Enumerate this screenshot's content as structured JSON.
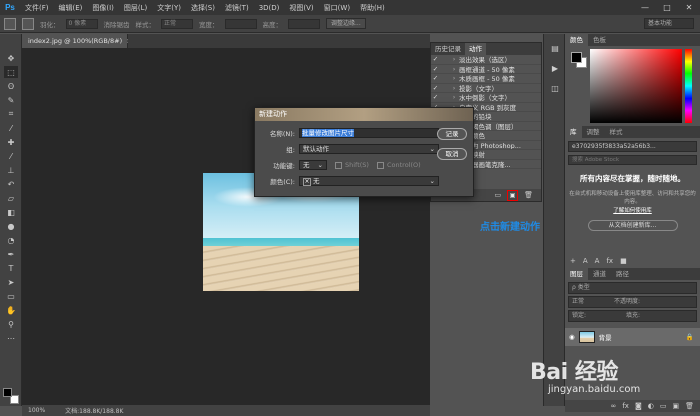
{
  "menu": {
    "logo": "Ps",
    "items": [
      "文件(F)",
      "编辑(E)",
      "图像(I)",
      "图层(L)",
      "文字(Y)",
      "选择(S)",
      "滤镜(T)",
      "3D(D)",
      "视图(V)",
      "窗口(W)",
      "帮助(H)"
    ],
    "controls": [
      "—",
      "□",
      "✕"
    ]
  },
  "options_bar": {
    "feather_label": "羽化：",
    "feather_value": "0 像素",
    "antialias_label": "消除锯齿",
    "style_label": "样式：",
    "style_value": "正常",
    "width_label": "宽度：",
    "height_label": "高度：",
    "refine_button": "调整边缘...",
    "workspace": "基本功能"
  },
  "document": {
    "tab_title": "index2.jpg @ 100%(RGB/8#)",
    "close_glyph": "×",
    "zoom": "100%",
    "doc_size": "文档:188.8K/188.8K"
  },
  "history_panel": {
    "tabs": [
      "历史记录",
      "动作"
    ],
    "actions": [
      {
        "label": "淡出效果（选区）",
        "checked": true
      },
      {
        "label": "画框通道 - 50 像素",
        "checked": true
      },
      {
        "label": "木质画框 - 50 像素",
        "checked": true
      },
      {
        "label": "投影（文字）",
        "checked": true
      },
      {
        "label": "水中倒影（文字）",
        "checked": true
      },
      {
        "label": "自定义 RGB 到灰度",
        "checked": true
      },
      {
        "label": "熔化的铅块",
        "checked": true
      },
      {
        "label": "制作褐色调（图层）",
        "checked": true
      },
      {
        "label": "四分颜色",
        "checked": true
      },
      {
        "label": "存储为 Photoshop...",
        "checked": true
      },
      {
        "label": "渐变映射",
        "checked": true
      },
      {
        "label": "混合器画笔克隆...",
        "checked": true
      }
    ],
    "new_action_icon": "new-action-icon",
    "delete_icon": "trash-icon"
  },
  "annotation": {
    "text": "点击新建动作",
    "color": "#1f8be5"
  },
  "dialog": {
    "title": "新建动作",
    "name_label": "名称(N):",
    "name_value": "批量修改图片尺寸",
    "group_label": "组:",
    "group_value": "默认动作",
    "fkey_label": "功能键:",
    "fkey_value": "无",
    "shift_label": "Shift(S)",
    "control_label": "Control(O)",
    "color_label": "颜色(C):",
    "color_value": "无",
    "record_button": "记录",
    "cancel_button": "取消"
  },
  "color_panel": {
    "tabs": [
      "颜色",
      "色板"
    ],
    "fg": "#000000",
    "bg": "#ffffff"
  },
  "library_panel": {
    "tabs": [
      "库",
      "调整",
      "样式"
    ],
    "library_id": "e3702935f3833a52a56b3...",
    "search_placeholder": "搜索 Adobe Stock",
    "headline": "所有内容尽在掌握，随时随地。",
    "body": "在台式机和移动设备上使用库整理、访问和共享您的内容。",
    "link": "了解如何使用库",
    "create_button": "从文档创建新库..."
  },
  "layers_panel": {
    "tabs": [
      "图层",
      "通道",
      "路径"
    ],
    "filter_label": "ρ 类型",
    "blend_mode": "正常",
    "opacity_label": "不透明度:",
    "lock_label": "锁定:",
    "fill_label": "填充:",
    "layer_name": "背景"
  },
  "watermark": {
    "main": "Bai 经验",
    "sub": "jingyan.baidu.com"
  }
}
